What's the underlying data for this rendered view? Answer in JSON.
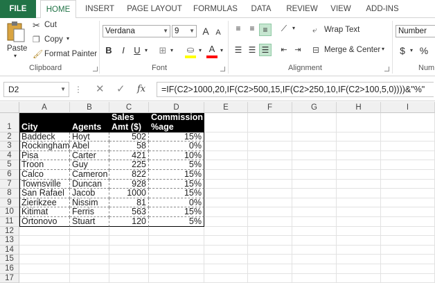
{
  "tabs": [
    "FILE",
    "HOME",
    "INSERT",
    "PAGE LAYOUT",
    "FORMULAS",
    "DATA",
    "REVIEW",
    "VIEW",
    "ADD-INS"
  ],
  "clipboard": {
    "paste": "Paste",
    "cut": "Cut",
    "copy": "Copy",
    "format_painter": "Format Painter",
    "label": "Clipboard"
  },
  "font": {
    "name": "Verdana",
    "size": "9",
    "label": "Font",
    "bold": "B",
    "italic": "I",
    "underline": "U",
    "grow": "A",
    "shrink": "A",
    "color_letter": "A"
  },
  "alignment": {
    "wrap_text": "Wrap Text",
    "merge_center": "Merge & Center",
    "label": "Alignment"
  },
  "number": {
    "format": "Number",
    "currency": "$",
    "percent": "%",
    "label": "Num"
  },
  "formula_bar": {
    "name_box": "D2",
    "fx": "fx",
    "formula": "=IF(C2>1000,20,IF(C2>500,15,IF(C2>250,10,IF(C2>100,5,0))))&\"%\""
  },
  "columns": [
    "A",
    "B",
    "C",
    "D",
    "E",
    "F",
    "G",
    "H",
    "I"
  ],
  "rows": [
    "1",
    "2",
    "3",
    "4",
    "5",
    "6",
    "7",
    "8",
    "9",
    "10",
    "11",
    "12",
    "13",
    "14",
    "15",
    "16",
    "17"
  ],
  "table": {
    "header_top": [
      "",
      "",
      "Sales",
      "Commission"
    ],
    "header_bottom": [
      "City",
      "Agents",
      "Amt ($)",
      "%age"
    ],
    "data": [
      [
        "Baddeck",
        "Hoyt",
        "502",
        "15%"
      ],
      [
        "Rockingham",
        "Abel",
        "58",
        "0%"
      ],
      [
        "Pisa",
        "Carter",
        "421",
        "10%"
      ],
      [
        "Troon",
        "Guy",
        "225",
        "5%"
      ],
      [
        "Calco",
        "Cameron",
        "822",
        "15%"
      ],
      [
        "Townsville",
        "Duncan",
        "928",
        "15%"
      ],
      [
        "San Rafael",
        "Jacob",
        "1000",
        "15%"
      ],
      [
        "Zierikzee",
        "Nissim",
        "81",
        "0%"
      ],
      [
        "Kitimat",
        "Ferris",
        "563",
        "15%"
      ],
      [
        "Ortonovo",
        "Stuart",
        "120",
        "5%"
      ]
    ]
  },
  "colors": {
    "file_tab": "#217346",
    "header_fill": "#000000",
    "fill_yellow": "#ffff00",
    "font_red": "#ff0000"
  }
}
